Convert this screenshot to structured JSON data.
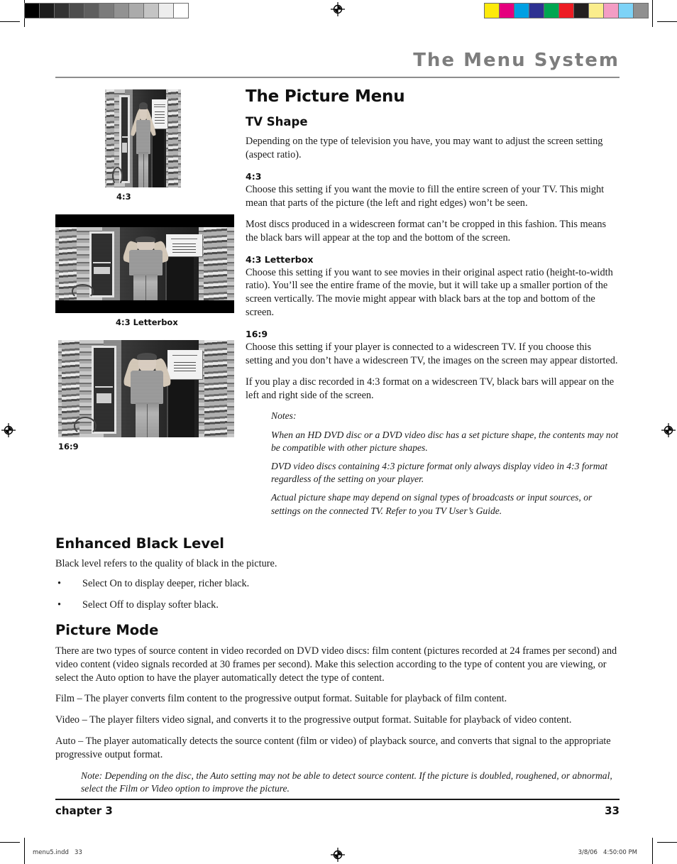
{
  "printer_marks": {
    "grayscale_bars": [
      "#000000",
      "#1c1c1c",
      "#333333",
      "#4d4d4d",
      "#5e5e5e",
      "#7b7b7b",
      "#929292",
      "#ababab",
      "#c4c4c4",
      "#ededed",
      "#ffffff"
    ],
    "color_bars": [
      "#fdea0b",
      "#e5007e",
      "#00a0e3",
      "#2e3192",
      "#00a651",
      "#ed1c24",
      "#231f20",
      "#faed8c",
      "#f39dc4",
      "#7dd3f7",
      "#909090"
    ],
    "registration_icon": "registration-target-icon"
  },
  "running_head": {
    "title": "The Menu System"
  },
  "main": {
    "section_title": "The Picture Menu",
    "tv_shape": {
      "heading": "TV Shape",
      "intro": "Depending on the type of television you have, you may want to adjust the screen setting (aspect ratio).",
      "items": [
        {
          "heading": "4:3",
          "paragraphs": [
            "Choose this setting if you want the movie to fill the entire screen of your TV. This might mean that parts of the picture (the left and right edges) won’t be seen.",
            "Most discs produced in a widescreen format can’t be cropped in this fashion. This means the black bars will appear at the top and the bottom of the screen."
          ]
        },
        {
          "heading": "4:3 Letterbox",
          "paragraphs": [
            "Choose this setting if you want to see movies in their original aspect ratio (height-to-width ratio). You’ll see the entire frame of the movie, but it will take up a smaller portion of the screen vertically. The movie might appear with black bars at the top and bottom of the screen."
          ]
        },
        {
          "heading": "16:9",
          "paragraphs": [
            "Choose this setting if your player is connected to a widescreen TV. If you choose this setting and you don’t have a widescreen TV, the images on the screen may appear distorted.",
            "If you play a disc recorded in 4:3 format on a widescreen TV, black bars will appear on the left and right side of the screen."
          ]
        }
      ],
      "notes_label": "Notes:",
      "notes": [
        "When an HD DVD disc or a DVD video disc has a set picture shape, the contents may not be compatible with other picture shapes.",
        "DVD video discs containing 4:3 picture format only always display video in 4:3 format regardless of the setting on your player.",
        "Actual picture shape may depend on signal types of broadcasts or input sources, or settings on the connected TV. Refer to you TV User’s Guide."
      ]
    },
    "figures": [
      {
        "caption": "4:3",
        "kind": "full"
      },
      {
        "caption": "4:3 Letterbox",
        "kind": "letterbox"
      },
      {
        "caption": "16:9",
        "kind": "widescreen"
      }
    ],
    "enhanced_black_level": {
      "heading": "Enhanced Black Level",
      "intro": "Black level refers to the quality of black in the picture.",
      "bullet_glyph": "•",
      "bullets": [
        "Select On to display deeper, richer black.",
        "Select Off to display softer black."
      ]
    },
    "picture_mode": {
      "heading": "Picture Mode",
      "paragraphs": [
        "There are two types of source content in video recorded on DVD video discs: film content (pictures recorded at 24 frames per second) and video content (video signals recorded at 30 frames per second). Make this selection according to the type of content you are viewing, or select the Auto option to have the player automatically detect the type of content.",
        "Film – The player converts film content to the progressive output format. Suitable for playback of film content.",
        "Video – The player filters video signal, and converts it to the progressive output format. Suitable for playback of video content.",
        "Auto – The player automatically detects the source content (film or video) of playback source, and converts that signal to the appropriate progressive output format."
      ],
      "note": "Note: Depending on the disc, the Auto setting may not be able to detect source content. If the picture is doubled, roughened, or abnormal, select the Film or Video option to improve the picture."
    }
  },
  "folio": {
    "chapter": "chapter 3",
    "page_number": "33"
  },
  "slug": {
    "left": "menu5.indd   33",
    "right": "3/8/06   4:50:00 PM"
  }
}
